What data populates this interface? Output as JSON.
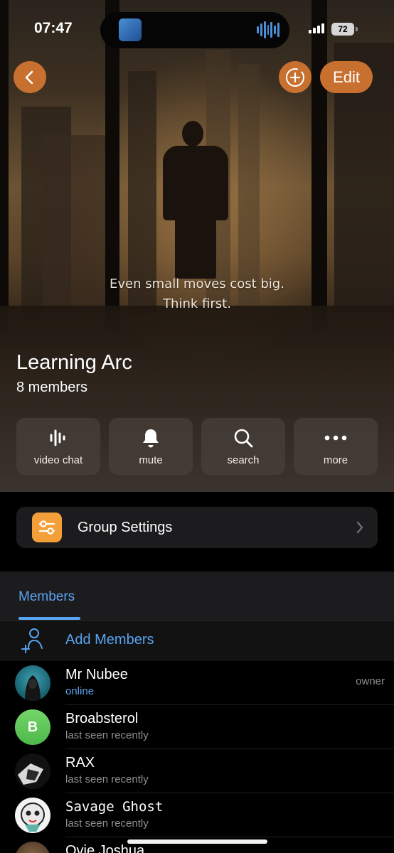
{
  "status_bar": {
    "time": "07:47",
    "battery": "72"
  },
  "header": {
    "edit_label": "Edit"
  },
  "hero": {
    "quote_line1": "Even small moves cost big.",
    "quote_line2": "Think first."
  },
  "group": {
    "title": "Learning Arc",
    "members_count": "8 members"
  },
  "actions": [
    {
      "label": "video chat",
      "icon": "voice-wave-icon"
    },
    {
      "label": "mute",
      "icon": "bell-icon"
    },
    {
      "label": "search",
      "icon": "search-icon"
    },
    {
      "label": "more",
      "icon": "more-dots-icon"
    }
  ],
  "settings": {
    "label": "Group Settings",
    "icon": "sliders-icon",
    "accent": "#f3a03a"
  },
  "members_tab": {
    "label": "Members"
  },
  "add_members": {
    "label": "Add Members"
  },
  "members": [
    {
      "name": "Mr Nubee",
      "status": "online",
      "role": "owner"
    },
    {
      "name": "Broabsterol",
      "status": "last seen recently",
      "initial": "B"
    },
    {
      "name": "RAX",
      "status": "last seen recently"
    },
    {
      "name": "Savage Ghost",
      "status": "last seen recently"
    },
    {
      "name": "Ovie Joshua"
    }
  ],
  "colors": {
    "accent_blue": "#5aa3f0",
    "header_button": "#c8702f"
  }
}
